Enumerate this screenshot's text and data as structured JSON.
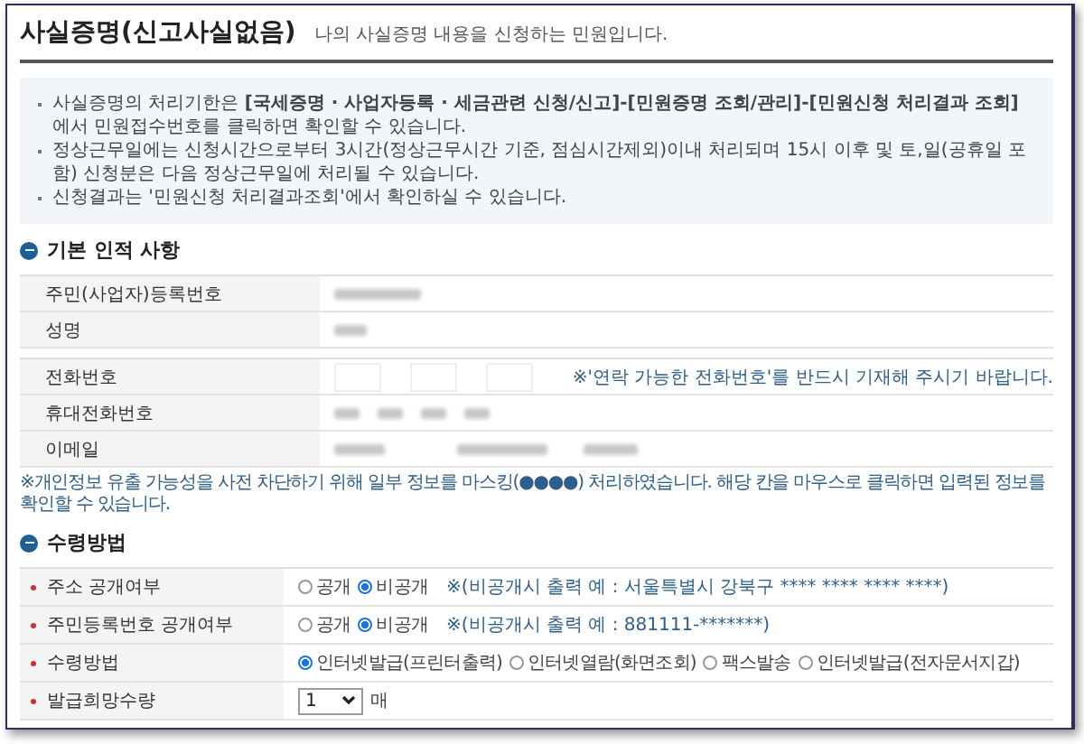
{
  "header": {
    "title": "사실증명(신고사실없음)",
    "subtitle": "나의 사실증명 내용을 신청하는 민원입니다."
  },
  "notices": [
    "사실증명의 처리기한은 **[국세증명 · 사업자등록 · 세금관련 신청/신고]-[민원증명 조회/관리]-[민원신청 처리결과 조회]**에서 민원접수번호를 클릭하면 확인할 수 있습니다.",
    "정상근무일에는 신청시간으로부터 3시간(정상근무시간 기준, 점심시간제외)이내 처리되며 15시 이후 및 토,일(공휴일 포함) 신청분은 다음 정상근무일에 처리될 수 있습니다.",
    "신청결과는 '민원신청 처리결과조회'에서 확인하실 수 있습니다."
  ],
  "basic_info": {
    "title": "기본 인적 사항",
    "rows": [
      {
        "label": "주민(사업자)등록번호",
        "kind": "text"
      },
      {
        "label": "성명",
        "kind": "text"
      },
      {
        "label": "전화번호",
        "kind": "phone",
        "note": "※'연락 가능한 전화번호'를 반드시 기재해 주시기 바랍니다."
      },
      {
        "label": "휴대전화번호",
        "kind": "mobile"
      },
      {
        "label": "이메일",
        "kind": "email"
      }
    ],
    "note": "※개인정보 유출 가능성을 사전 차단하기 위해 일부 정보를 마스킹(●●●●) 처리하였습니다. 해당 칸을 마우스로 클릭하면 입력된 정보를 확인할 수 있습니다."
  },
  "receipt": {
    "title": "수령방법",
    "rows": [
      {
        "label": "주소 공개여부",
        "kind": "radio",
        "options": [
          {
            "label": "공개",
            "selected": false
          },
          {
            "label": "비공개",
            "selected": true
          }
        ],
        "note": "※(비공개시 출력 예 : 서울특별시 강북구 **** **** **** ****)"
      },
      {
        "label": "주민등록번호 공개여부",
        "kind": "radio",
        "options": [
          {
            "label": "공개",
            "selected": false
          },
          {
            "label": "비공개",
            "selected": true
          }
        ],
        "note": "※(비공개시 출력 예 : 881111-*******)"
      },
      {
        "label": "수령방법",
        "kind": "radio",
        "options": [
          {
            "label": "인터넷발급(프린터출력)",
            "selected": true
          },
          {
            "label": "인터넷열람(화면조회)",
            "selected": false
          },
          {
            "label": "팩스발송",
            "selected": false
          },
          {
            "label": "인터넷발급(전자문서지갑)",
            "selected": false
          }
        ]
      },
      {
        "label": "발급희망수량",
        "kind": "select",
        "value": "1",
        "unit": "매"
      }
    ]
  }
}
